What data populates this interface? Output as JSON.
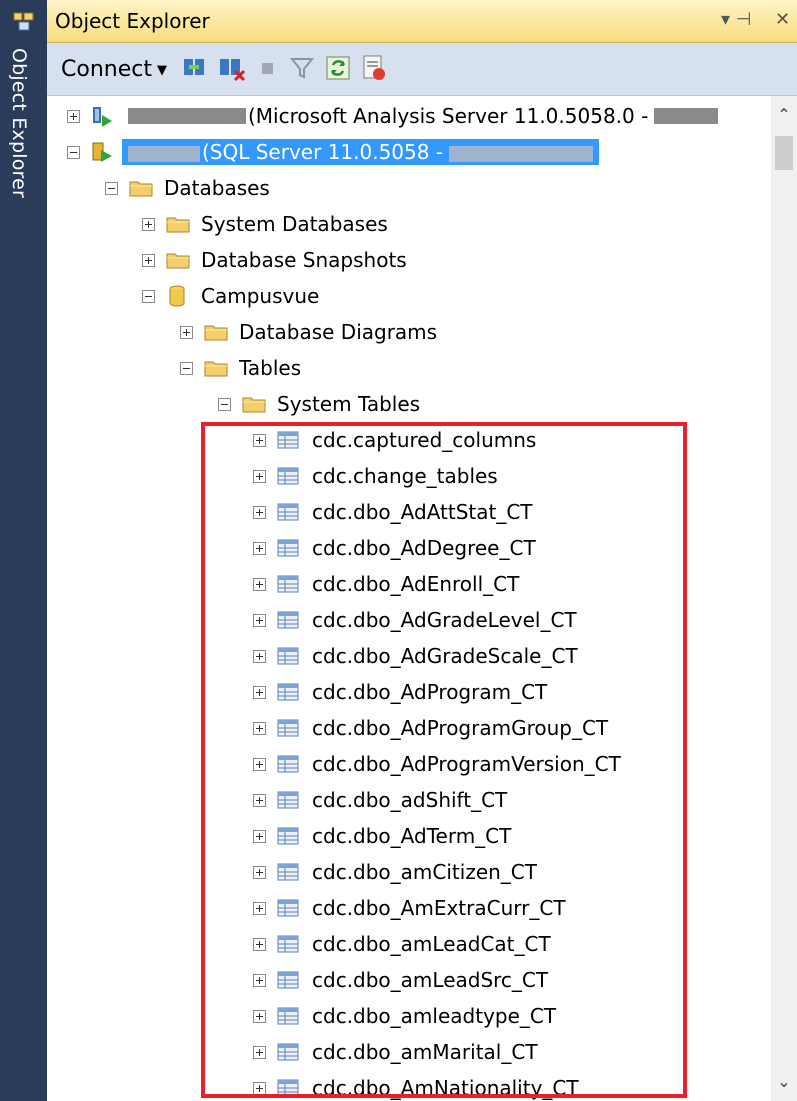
{
  "side_tab": {
    "label": "Object Explorer"
  },
  "titlebar": {
    "title": "Object Explorer",
    "pin_glyph": "▾ ⊣",
    "close_glyph": "✕"
  },
  "toolbar": {
    "connect_label": "Connect",
    "buttons": [
      "connect-object-icon",
      "disconnect-icon",
      "stop-icon",
      "filter-icon",
      "refresh-icon",
      "activity-monitor-icon"
    ]
  },
  "tree": {
    "analysis_server": {
      "label": "(Microsoft Analysis Server 11.0.5058.0 -"
    },
    "sql_server": {
      "label": "(SQL Server 11.0.5058 -"
    },
    "databases": "Databases",
    "system_databases": "System Databases",
    "database_snapshots": "Database Snapshots",
    "campusvue": "Campusvue",
    "database_diagrams": "Database Diagrams",
    "tables": "Tables",
    "system_tables": "System Tables",
    "table_items": [
      "cdc.captured_columns",
      "cdc.change_tables",
      "cdc.dbo_AdAttStat_CT",
      "cdc.dbo_AdDegree_CT",
      "cdc.dbo_AdEnroll_CT",
      "cdc.dbo_AdGradeLevel_CT",
      "cdc.dbo_AdGradeScale_CT",
      "cdc.dbo_AdProgram_CT",
      "cdc.dbo_AdProgramGroup_CT",
      "cdc.dbo_AdProgramVersion_CT",
      "cdc.dbo_adShift_CT",
      "cdc.dbo_AdTerm_CT",
      "cdc.dbo_amCitizen_CT",
      "cdc.dbo_AmExtraCurr_CT",
      "cdc.dbo_amLeadCat_CT",
      "cdc.dbo_amLeadSrc_CT",
      "cdc.dbo_amleadtype_CT",
      "cdc.dbo_amMarital_CT",
      "cdc.dbo_AmNationality_CT"
    ]
  },
  "colors": {
    "accent_selection": "#3399ff",
    "highlight_box": "#e8202a",
    "side_tab": "#2b3c5a"
  }
}
